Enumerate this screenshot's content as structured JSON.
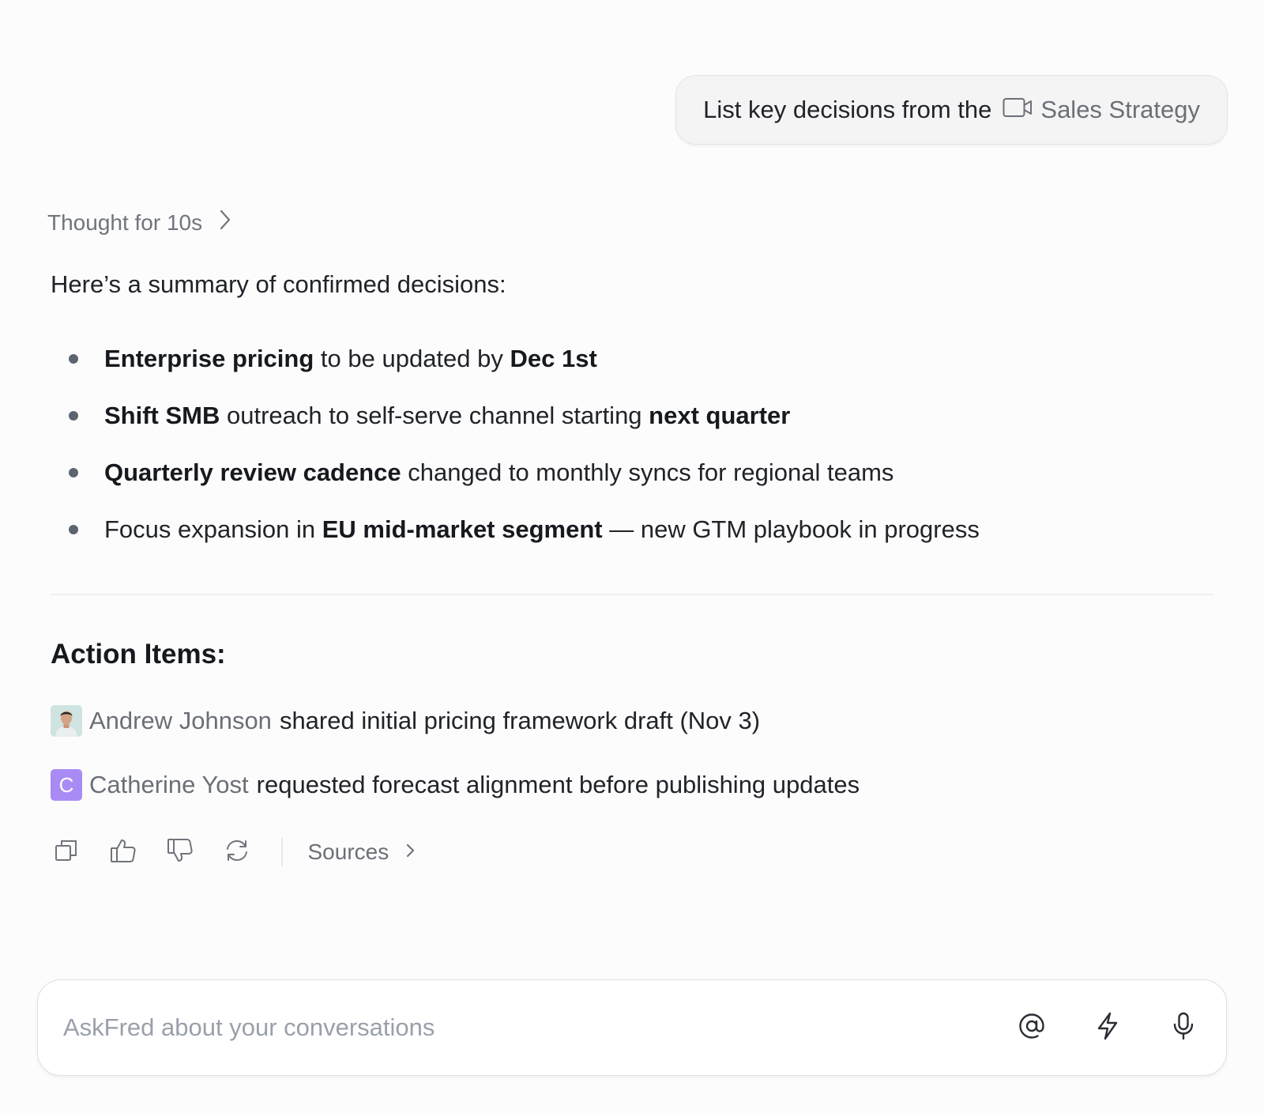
{
  "user_message": {
    "text": "List key decisions from the",
    "chip_icon": "video-camera-icon",
    "chip_label": "Sales Strategy"
  },
  "thought": {
    "label": "Thought for 10s"
  },
  "response": {
    "intro": "Here’s a summary of confirmed decisions:",
    "bullets": [
      {
        "parts": [
          {
            "bold": true,
            "text": "Enterprise pricing"
          },
          {
            "bold": false,
            "text": " to be updated by "
          },
          {
            "bold": true,
            "text": "Dec 1st"
          }
        ]
      },
      {
        "parts": [
          {
            "bold": true,
            "text": "Shift SMB"
          },
          {
            "bold": false,
            "text": " outreach to self-serve channel starting "
          },
          {
            "bold": true,
            "text": "next quarter"
          }
        ]
      },
      {
        "parts": [
          {
            "bold": true,
            "text": "Quarterly review cadence"
          },
          {
            "bold": false,
            "text": " changed to monthly syncs for regional teams"
          }
        ]
      },
      {
        "parts": [
          {
            "bold": false,
            "text": "Focus expansion in "
          },
          {
            "bold": true,
            "text": "EU mid-market segment"
          },
          {
            "bold": false,
            "text": " — new GTM playbook in progress"
          }
        ]
      }
    ],
    "action_title": "Action Items:",
    "actions": [
      {
        "person": "Andrew Johnson",
        "text": "shared initial pricing framework draft (Nov 3)",
        "avatar": "photo"
      },
      {
        "person": "Catherine Yost",
        "text": "requested forecast alignment before publishing updates",
        "avatar_initial": "C",
        "avatar_color": "#a98bf5"
      }
    ]
  },
  "toolbar": {
    "icons": [
      "copy-icon",
      "thumbs-up-icon",
      "thumbs-down-icon",
      "regenerate-icon"
    ],
    "sources_label": "Sources"
  },
  "input": {
    "placeholder": "AskFred about your conversations",
    "value": "",
    "icons": [
      "at-mention-icon",
      "lightning-icon",
      "microphone-icon"
    ]
  }
}
